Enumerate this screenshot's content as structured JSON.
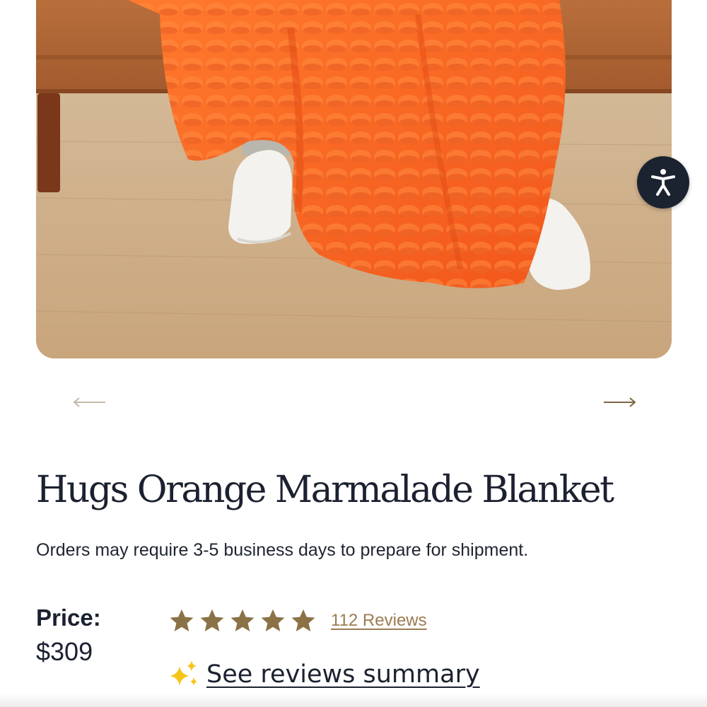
{
  "product": {
    "image_icon": "product-photo",
    "title": "Hugs Orange Marmalade Blanket",
    "shipping_note": "Orders may require 3-5 business days to prepare for shipment.",
    "price_label": "Price:",
    "price": "$309"
  },
  "carousel": {
    "prev_icon": "arrow-left-icon",
    "next_icon": "arrow-right-icon"
  },
  "rating": {
    "stars": 5,
    "max_stars": 5,
    "reviews_label": "112 Reviews",
    "star_color": "#8b7146"
  },
  "summary": {
    "icon": "sparkle-icon",
    "label": "See reviews summary",
    "icon_color": "#f5c518"
  },
  "accessibility": {
    "icon": "accessibility-icon",
    "background": "#1c2330"
  },
  "colors": {
    "accent": "#9b7b52",
    "text": "#1b2130"
  }
}
